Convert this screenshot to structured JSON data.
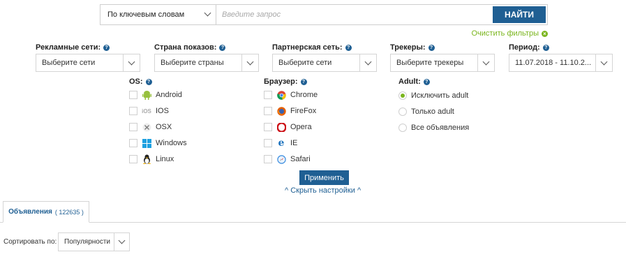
{
  "search": {
    "mode": "По ключевым словам",
    "placeholder": "Введите запрос",
    "button": "НАЙТИ",
    "clear_filters": "Очистить фильтры"
  },
  "filters": [
    {
      "label": "Рекламные сети:",
      "value": "Выберите сети"
    },
    {
      "label": "Страна показов:",
      "value": "Выберите страны"
    },
    {
      "label": "Партнерская сеть:",
      "value": "Выберите сети"
    },
    {
      "label": "Трекеры:",
      "value": "Выберите трекеры"
    },
    {
      "label": "Период:",
      "value": "11.07.2018 - 11.10.2..."
    }
  ],
  "os": {
    "label": "OS:",
    "items": [
      {
        "label": "Android",
        "icon": "android-icon",
        "checked": false
      },
      {
        "label": "IOS",
        "icon": "ios-icon",
        "checked": false
      },
      {
        "label": "OSX",
        "icon": "osx-icon",
        "checked": false
      },
      {
        "label": "Windows",
        "icon": "windows-icon",
        "checked": false
      },
      {
        "label": "Linux",
        "icon": "linux-icon",
        "checked": false
      }
    ]
  },
  "browser": {
    "label": "Браузер:",
    "items": [
      {
        "label": "Chrome",
        "icon": "chrome-icon",
        "checked": false
      },
      {
        "label": "FireFox",
        "icon": "firefox-icon",
        "checked": false
      },
      {
        "label": "Opera",
        "icon": "opera-icon",
        "checked": false
      },
      {
        "label": "IE",
        "icon": "ie-icon",
        "checked": false
      },
      {
        "label": "Safari",
        "icon": "safari-icon",
        "checked": false
      }
    ]
  },
  "adult": {
    "label": "Adult:",
    "items": [
      {
        "label": "Исключить adult",
        "selected": true
      },
      {
        "label": "Только adult",
        "selected": false
      },
      {
        "label": "Все объявления",
        "selected": false
      }
    ]
  },
  "apply": "Применить",
  "hide_settings": "^ Скрыть настройки ^",
  "tab": {
    "label": "Объявления",
    "count": "( 122635 )"
  },
  "sort": {
    "label": "Сортировать по:",
    "value": "Популярности"
  },
  "colors": {
    "primary": "#1f5f93",
    "accent_green": "#7ab51d"
  }
}
